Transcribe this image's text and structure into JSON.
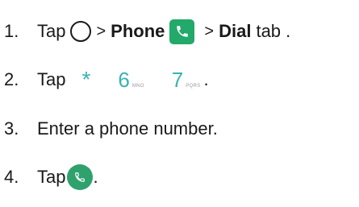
{
  "steps": [
    {
      "number": "1.",
      "tap": "Tap",
      "sep1": ">",
      "app": "Phone",
      "sep2": ">",
      "tab": "Dial",
      "tab_suffix": "tab ."
    },
    {
      "number": "2.",
      "tap": "Tap",
      "keys": [
        {
          "main": "*",
          "sub": ""
        },
        {
          "main": "6",
          "sub": "MNO"
        },
        {
          "main": "7",
          "sub": "PQRS"
        }
      ],
      "end": "."
    },
    {
      "number": "3.",
      "text": "Enter a phone number."
    },
    {
      "number": "4.",
      "tap": "Tap",
      "end": "."
    }
  ],
  "icons": {
    "home": "home-circle-icon",
    "phone_app": "phone-app-icon",
    "call": "call-button-icon"
  },
  "colors": {
    "text": "#1a1a1a",
    "phone_app_bg": "#23a96a",
    "keypad_digit": "#3ab2b2",
    "call_button": "#2fa16d"
  }
}
